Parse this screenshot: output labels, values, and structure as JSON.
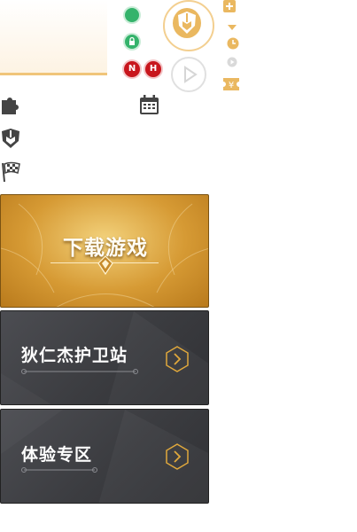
{
  "top": {
    "badge_n": "N",
    "badge_h": "H"
  },
  "banners": {
    "download": "下载游戏",
    "guard_station": "狄仁杰护卫站",
    "experience_zone": "体验专区"
  },
  "icons": {
    "plus": "plus-icon",
    "arrow": "caret-down-icon",
    "clock": "clock-icon",
    "play_small": "play-icon",
    "ticket": "ticket-icon",
    "puzzle": "puzzle-icon",
    "helmet": "helmet-icon",
    "flag": "checkered-flag-icon",
    "calendar": "calendar-icon",
    "chevron": "chevron-right-icon"
  },
  "colors": {
    "gold": "#eab860",
    "green": "#34b36b",
    "red": "#c8161d"
  }
}
